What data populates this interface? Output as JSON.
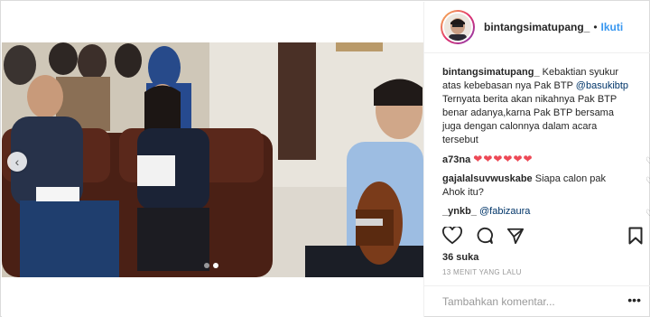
{
  "post": {
    "username": "bintangsimatupang_",
    "separator": "•",
    "follow_label": "Ikuti",
    "likes": "36 suka",
    "timestamp": "13 MENIT YANG LALU",
    "comment_placeholder": "Tambahkan komentar..."
  },
  "caption": {
    "user": "bintangsimatupang_",
    "text_1": "Kebaktian syukur atas kebebasan nya Pak BTP",
    "mention": "@basukibtp",
    "text_2": "Ternyata berita akan nikahnya Pak BTP benar adanya,karna Pak BTP bersama juga dengan calonnya dalam acara tersebut"
  },
  "comments": [
    {
      "user": "a73na",
      "text": "❤❤❤❤❤❤"
    },
    {
      "user": "gajalalsuvwuskabe",
      "text": "Siapa calon pak Ahok itu?"
    },
    {
      "user": "_ynkb_",
      "mention": "@fabizaura"
    }
  ],
  "carousel": {
    "prev_glyph": "‹",
    "dots": 2,
    "active_dot": 1
  },
  "icons": {
    "like": "heart-icon",
    "comment": "comment-icon",
    "share": "share-icon",
    "save": "bookmark-icon",
    "more": "more-options-icon"
  },
  "colors": {
    "link": "#3897f0",
    "mention": "#003569",
    "heart": "#ed4956",
    "muted": "#999999"
  }
}
